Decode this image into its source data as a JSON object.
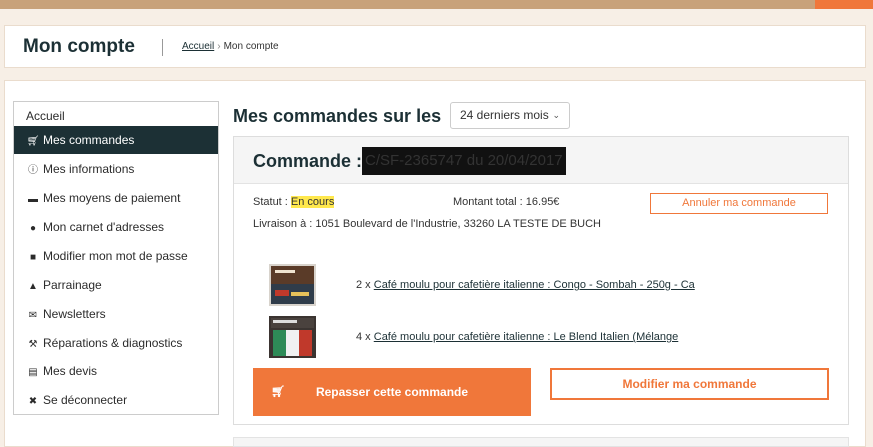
{
  "header": {
    "title": "Mon compte",
    "breadcrumb": {
      "home": "Accueil",
      "separator": "›",
      "current": "Mon compte"
    }
  },
  "sidebar": {
    "items": [
      {
        "label": "Accueil",
        "icon": "none"
      },
      {
        "label": "Mes commandes",
        "icon": "cart-icon"
      },
      {
        "label": "Mes informations",
        "icon": "info-icon"
      },
      {
        "label": "Mes moyens de paiement",
        "icon": "credit-card-icon"
      },
      {
        "label": "Mon carnet d'adresses",
        "icon": "map-marker-icon"
      },
      {
        "label": "Modifier mon mot de passe",
        "icon": "lock-icon"
      },
      {
        "label": "Parrainage",
        "icon": "thumbs-up-icon"
      },
      {
        "label": "Newsletters",
        "icon": "envelope-icon"
      },
      {
        "label": "Réparations & diagnostics",
        "icon": "wrench-icon"
      },
      {
        "label": "Mes devis",
        "icon": "document-icon"
      },
      {
        "label": "Se déconnecter",
        "icon": "close-circle-icon"
      }
    ]
  },
  "orders": {
    "heading": "Mes commandes sur les",
    "period": "24 derniers mois"
  },
  "order": {
    "label": "Commande :",
    "reference": "C/SF-2365747 du 20/04/2017",
    "status_label": "Statut :",
    "status_value": "En cours",
    "total_label": "Montant total :",
    "total_value": "16.95€",
    "cancel_label": "Annuler ma commande",
    "delivery_label": "Livraison à :",
    "delivery_address": "1051 Boulevard de l'Industrie, 33260 LA TESTE DE BUCH",
    "products": [
      {
        "qty": "2 x",
        "name": "Café moulu pour cafetière italienne : Congo - Sombah - 250g - Ca"
      },
      {
        "qty": "4 x",
        "name": "Café moulu pour cafetière italienne : Le Blend Italien (Mélange"
      }
    ],
    "reorder_label": "Repasser cette commande",
    "modify_label": "Modifier ma commande"
  },
  "colors": {
    "accent": "#f0773a",
    "dark": "#1c3035",
    "highlight": "#ffe84d"
  }
}
